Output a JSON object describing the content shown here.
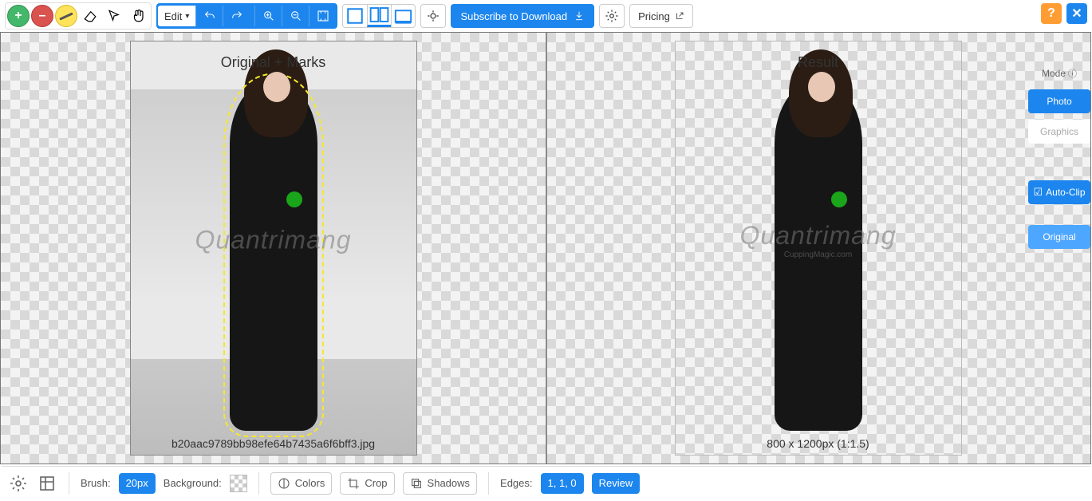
{
  "toolbar": {
    "edit_label": "Edit",
    "subscribe_label": "Subscribe to Download",
    "pricing_label": "Pricing"
  },
  "panels": {
    "left_label": "Original + Marks",
    "right_label": "Result",
    "filename": "b20aac9789bb98efe64b7435a6f6bff3.jpg",
    "result_dims": "800 x 1200px (1:1.5)",
    "watermark_main": "Quantrimang",
    "watermark_sub": "CuppingMagic.com"
  },
  "sidepanel": {
    "mode_label": "Mode",
    "photo_label": "Photo",
    "graphics_label": "Graphics",
    "autoclip_label": "Auto-Clip",
    "original_label": "Original"
  },
  "bottombar": {
    "brush_label": "Brush:",
    "brush_value": "20px",
    "background_label": "Background:",
    "colors_label": "Colors",
    "crop_label": "Crop",
    "shadows_label": "Shadows",
    "edges_label": "Edges:",
    "edges_value": "1, 1, 0",
    "review_label": "Review"
  }
}
